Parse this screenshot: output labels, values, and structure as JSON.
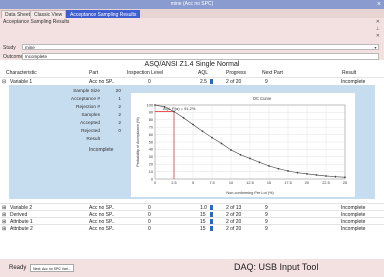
{
  "window": {
    "title": "mine (Acc no SPC)",
    "close": "×"
  },
  "tabs": [
    {
      "label": "Data Sheet"
    },
    {
      "label": "Classic View"
    },
    {
      "label": "Acceptance Sampling Results"
    }
  ],
  "subtitle": "Acceptance Sampling Results",
  "study": {
    "label": "Study",
    "value": "mine"
  },
  "outcome": {
    "label": "Outcome",
    "value": "Incomplete"
  },
  "table": {
    "title": "ASQ/ANSI Z1.4 Single Normal",
    "columns": [
      "Characteristic",
      "Part",
      "Inspection Level",
      "AQL",
      "Progress",
      "Next Part",
      "Result"
    ],
    "rows": [
      {
        "expander": "⊟",
        "name": "Variable 1",
        "part": "Acc no SP..",
        "level": "0",
        "aql": "2.5",
        "progress": "2 of 20",
        "next": "9",
        "result": "Incomplete"
      },
      {
        "expander": "⊞",
        "name": "Variable 2",
        "part": "Acc no SP..",
        "level": "0",
        "aql": "1.0",
        "progress": "2 of 13",
        "next": "9",
        "result": "Incomplete"
      },
      {
        "expander": "⊞",
        "name": "Derived",
        "part": "Acc no SP..",
        "level": "0",
        "aql": "15",
        "progress": "2 of 20",
        "next": "9",
        "result": "Incomplete"
      },
      {
        "expander": "⊞",
        "name": "Attribute 1",
        "part": "Acc no SP..",
        "level": "0",
        "aql": "15",
        "progress": "2 of 20",
        "next": "9",
        "result": "Incomplete"
      },
      {
        "expander": "⊞",
        "name": "Attribute 2",
        "part": "Acc no SP..",
        "level": "0",
        "aql": "15",
        "progress": "2 of 20",
        "next": "9",
        "result": "Incomplete"
      }
    ]
  },
  "details": [
    {
      "name": "Sample Size",
      "value": "20"
    },
    {
      "name": "Acceptance #",
      "value": "1"
    },
    {
      "name": "Rejection #",
      "value": "2"
    },
    {
      "name": "Samples",
      "value": "2"
    },
    {
      "name": "Accepted",
      "value": "2"
    },
    {
      "name": "Rejected",
      "value": "0"
    },
    {
      "name": "Result",
      "value": ""
    }
  ],
  "result_value": "Incomplete",
  "chart_data": {
    "type": "line",
    "title": "OC Curve",
    "xlabel": "Non-conforming Per Lot (%)",
    "ylabel": "Probability of Acceptance (%)",
    "annotation": "AQL P(a) = 91.2%",
    "x_ticks": [
      "0",
      "2.5",
      "5",
      "7.5",
      "10",
      "12.5",
      "15",
      "17.5",
      "20",
      "22.5",
      "25"
    ],
    "y_ticks": [
      "0",
      "10",
      "20",
      "30",
      "40",
      "50",
      "60",
      "70",
      "80",
      "90",
      "100"
    ],
    "xlim": [
      0,
      25
    ],
    "ylim": [
      0,
      100
    ],
    "grid": true,
    "series": [
      {
        "x": [
          0,
          1.25,
          2.5,
          3.75,
          5,
          6.25,
          7.5,
          8.75,
          10,
          11.25,
          12.5,
          13.75,
          15,
          16.25,
          17.5,
          18.75,
          20,
          21.25,
          22.5,
          23.75,
          25
        ],
        "y": [
          100,
          97.5,
          91.2,
          82.7,
          73.6,
          64.5,
          55.9,
          48.0,
          39.2,
          32.8,
          27.8,
          22.5,
          17.6,
          13.9,
          10.9,
          8.5,
          6.9,
          5.4,
          4.1,
          3.1,
          2.4
        ]
      }
    ],
    "reference": {
      "x": 2.5,
      "y": 91.2
    }
  },
  "status": {
    "ready": "Ready",
    "next_button": "Next: Acc no SPC Vari...",
    "daq": "DAQ: USB Input Tool"
  },
  "colors": {
    "titlebar": "#8a9bd0",
    "active_tab": "#3f5ed2",
    "panel": "#c6dcef",
    "bar": "#1e6ad6",
    "curve": "#555555",
    "reference": "#e02020"
  }
}
